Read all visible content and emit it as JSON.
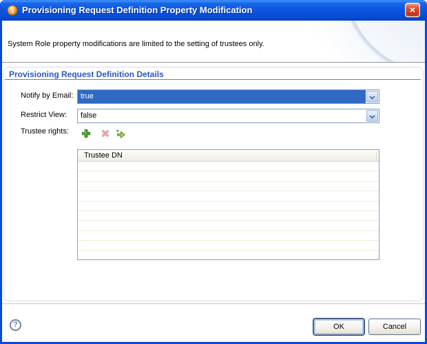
{
  "window": {
    "title": "Provisioning Request Definition Property Modification",
    "close_glyph": "×"
  },
  "banner": {
    "message": "System Role property modifications are limited to the setting of trustees only."
  },
  "details": {
    "section_title": "Provisioning Request Definition Details",
    "notify_by_email": {
      "label": "Notify by Email:",
      "value": "true"
    },
    "restrict_view": {
      "label": "Restrict View:",
      "value": "false"
    },
    "trustee_rights": {
      "label": "Trustee rights:"
    }
  },
  "trustee_table": {
    "header": "Trustee DN",
    "rows": [
      "",
      "",
      "",
      "",
      "",
      "",
      "",
      "",
      "",
      ""
    ]
  },
  "footer": {
    "help_glyph": "?",
    "ok_label": "OK",
    "cancel_label": "Cancel"
  },
  "icons": {
    "app_icon": "orange-key-badge",
    "add": "green-plus",
    "delete": "red-x-disabled",
    "assign": "green-arrow-plus",
    "combo_arrow": "chevron-down"
  },
  "colors": {
    "titlebar_blue": "#0A52DC",
    "frame_blue": "#0749DC",
    "selection_blue": "#316AC5",
    "section_title_blue": "#2857C0",
    "combo_border": "#7F9DB9",
    "table_border": "#8BA0B9",
    "table_header_bg": "#F6F4ED",
    "row_separator": "#F0ECD8",
    "close_red": "#CE3A1F"
  }
}
